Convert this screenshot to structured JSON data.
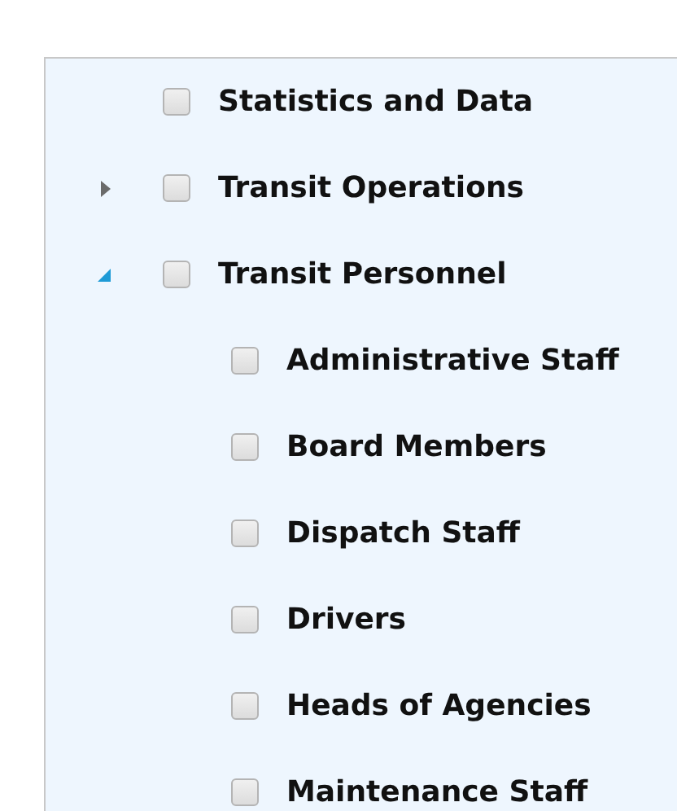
{
  "tree": [
    {
      "label": "Statistics and Data",
      "checked": false
    },
    {
      "label": "Transit Operations",
      "checked": false,
      "expanded": false
    },
    {
      "label": "Transit Personnel",
      "checked": false,
      "expanded": true,
      "children": [
        {
          "label": "Administrative Staff",
          "checked": false
        },
        {
          "label": "Board Members",
          "checked": false
        },
        {
          "label": "Dispatch Staff",
          "checked": false
        },
        {
          "label": "Drivers",
          "checked": false
        },
        {
          "label": "Heads of Agencies",
          "checked": false
        },
        {
          "label": "Maintenance Staff",
          "checked": false
        }
      ]
    }
  ]
}
